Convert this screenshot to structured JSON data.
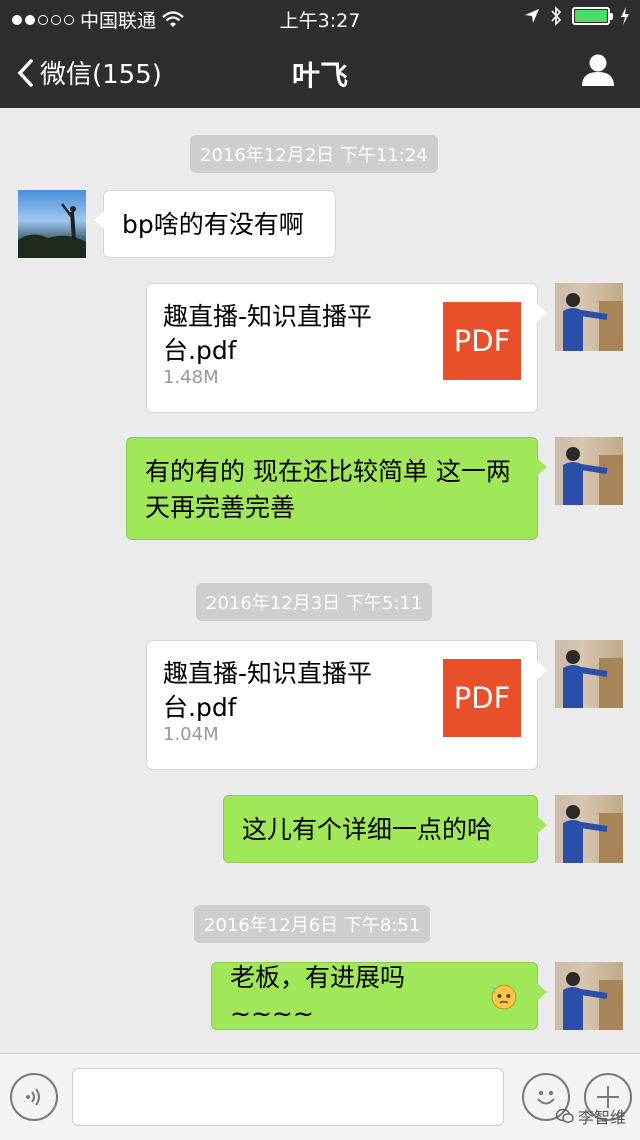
{
  "status": {
    "carrier": "中国联通",
    "time": "上午3:27"
  },
  "nav": {
    "back_label": "微信(155)",
    "title": "叶飞"
  },
  "messages": [
    {
      "timestamp": "2016年12月2日 下午11:24"
    },
    {
      "text": "bp啥的有没有啊"
    },
    {
      "file_name": "趣直播-知识直播平台.pdf",
      "file_size": "1.48M",
      "file_type": "PDF"
    },
    {
      "text": "有的有的 现在还比较简单 这一两天再完善完善"
    },
    {
      "timestamp": "2016年12月3日 下午5:11"
    },
    {
      "file_name": "趣直播-知识直播平台.pdf",
      "file_size": "1.04M",
      "file_type": "PDF"
    },
    {
      "text": "这儿有个详细一点的哈"
    },
    {
      "timestamp": "2016年12月6日 下午8:51"
    },
    {
      "text": "老板，有进展吗~~~~"
    }
  ],
  "watermark": "李智维",
  "colors": {
    "bar": "#2e2e30",
    "green_bubble": "#a0e75a",
    "pdf": "#e7502b"
  }
}
